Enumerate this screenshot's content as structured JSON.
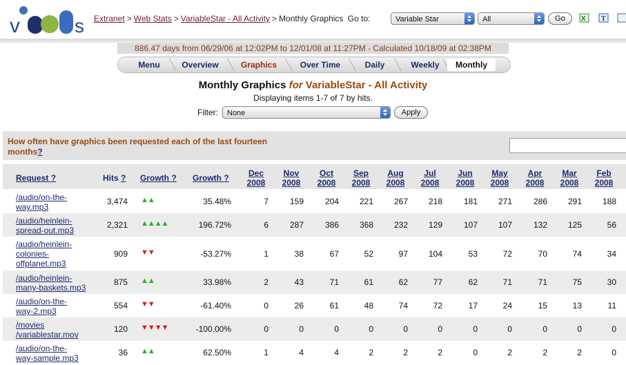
{
  "header": {
    "breadcrumbs": [
      "Extranet",
      "Web Stats",
      "VariableStar - All Activity"
    ],
    "current": "Monthly Graphics",
    "goto_label": "Go to:",
    "goto_select": "Variable Star",
    "scope_select": "All",
    "go_button": "Go",
    "icons": [
      "excel-icon",
      "text-icon",
      "extra-icon"
    ]
  },
  "range_text": "886.47 days from 06/29/06 at 12:02PM to 12/01/08 at 11:27PM - Calculated 10/18/09 at 02:38PM",
  "tabs": [
    "Menu",
    "Overview",
    "Graphics",
    "Over Time",
    "Daily",
    "Weekly",
    "Monthly"
  ],
  "title": {
    "main": "Monthly Graphics",
    "for": "for",
    "entity": "VariableStar - All Activity"
  },
  "subtitle": "Displaying items 1-7 of 7 by hits.",
  "filter": {
    "label": "Filter:",
    "value": "None",
    "apply": "Apply"
  },
  "question": {
    "text": "How often have graphics been requested each of the last fourteen months",
    "help": "?"
  },
  "table": {
    "headers": {
      "request": "Request",
      "hits": "Hits",
      "growth": "Growth",
      "growth_pct": "Growth",
      "help": "?"
    },
    "months": [
      {
        "m": "Dec",
        "y": "2008"
      },
      {
        "m": "Nov",
        "y": "2008"
      },
      {
        "m": "Oct",
        "y": "2008"
      },
      {
        "m": "Sep",
        "y": "2008"
      },
      {
        "m": "Aug",
        "y": "2008"
      },
      {
        "m": "Jul",
        "y": "2008"
      },
      {
        "m": "Jun",
        "y": "2008"
      },
      {
        "m": "May",
        "y": "2008"
      },
      {
        "m": "Apr",
        "y": "2008"
      },
      {
        "m": "Mar",
        "y": "2008"
      },
      {
        "m": "Feb",
        "y": "2008"
      }
    ],
    "rows": [
      {
        "request": [
          "/audio/on-the-",
          "way.mp3"
        ],
        "hits": "3,474",
        "arrows": "▲▲",
        "dir": "up",
        "pct": "35.48%",
        "vals": [
          "7",
          "159",
          "204",
          "221",
          "267",
          "218",
          "181",
          "271",
          "286",
          "291",
          "188"
        ]
      },
      {
        "request": [
          "/audio/heinlein-",
          "spread-out.mp3"
        ],
        "hits": "2,321",
        "arrows": "▲▲▲▲",
        "dir": "up",
        "pct": "196.72%",
        "vals": [
          "6",
          "287",
          "386",
          "368",
          "232",
          "129",
          "107",
          "107",
          "132",
          "125",
          "56"
        ]
      },
      {
        "request": [
          "/audio/heinlein-",
          "colonies-",
          "offplanet.mp3"
        ],
        "hits": "909",
        "arrows": "▼▼",
        "dir": "down",
        "pct": "-53.27%",
        "vals": [
          "1",
          "38",
          "67",
          "52",
          "97",
          "104",
          "53",
          "72",
          "70",
          "74",
          "34"
        ]
      },
      {
        "request": [
          "/audio/heinlein-",
          "many-baskets.mp3"
        ],
        "hits": "875",
        "arrows": "▲▲",
        "dir": "up",
        "pct": "33.98%",
        "vals": [
          "2",
          "43",
          "71",
          "61",
          "62",
          "77",
          "62",
          "71",
          "71",
          "75",
          "30"
        ]
      },
      {
        "request": [
          "/audio/on-the-",
          "way-2.mp3"
        ],
        "hits": "554",
        "arrows": "▼▼",
        "dir": "down",
        "pct": "-61.40%",
        "vals": [
          "0",
          "26",
          "61",
          "48",
          "74",
          "72",
          "17",
          "24",
          "15",
          "13",
          "11"
        ]
      },
      {
        "request": [
          "/movies",
          "/variablestar.mov"
        ],
        "hits": "120",
        "arrows": "▼▼▼▼",
        "dir": "down",
        "pct": "-100.00%",
        "vals": [
          "0",
          "0",
          "0",
          "0",
          "0",
          "0",
          "0",
          "0",
          "0",
          "0",
          "0"
        ]
      },
      {
        "request": [
          "/audio/on-the-",
          "way-sample.mp3"
        ],
        "hits": "36",
        "arrows": "▲▲",
        "dir": "up",
        "pct": "62.50%",
        "vals": [
          "1",
          "4",
          "4",
          "2",
          "2",
          "2",
          "0",
          "2",
          "2",
          "2",
          "0"
        ]
      }
    ]
  }
}
